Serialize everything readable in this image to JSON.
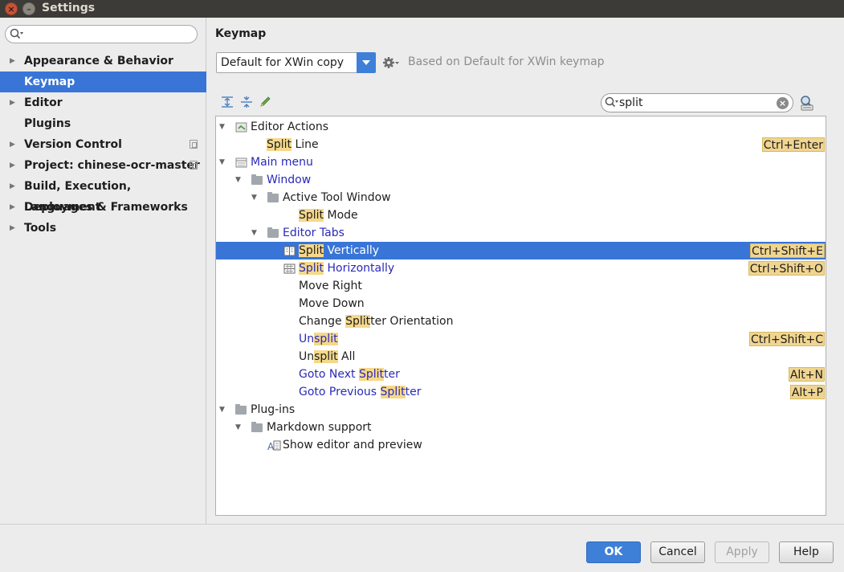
{
  "window": {
    "title": "Settings"
  },
  "sidebar": {
    "search_placeholder": "",
    "items": [
      {
        "label": "Appearance & Behavior",
        "expandable": true
      },
      {
        "label": "Keymap",
        "expandable": false,
        "selected": true
      },
      {
        "label": "Editor",
        "expandable": true
      },
      {
        "label": "Plugins",
        "expandable": false
      },
      {
        "label": "Version Control",
        "expandable": true,
        "project_icon": true
      },
      {
        "label": "Project: chinese-ocr-master",
        "expandable": true,
        "project_icon": true
      },
      {
        "label": "Build, Execution, Deployment",
        "expandable": true
      },
      {
        "label": "Languages & Frameworks",
        "expandable": true
      },
      {
        "label": "Tools",
        "expandable": true
      }
    ]
  },
  "keymap": {
    "title": "Keymap",
    "scheme": "Default for XWin copy",
    "based_on": "Based on Default for XWin keymap",
    "search_value": "split"
  },
  "tree": [
    {
      "parts": [
        [
          "Editor Actions",
          false
        ]
      ],
      "blue": false,
      "shortcut": ""
    },
    {
      "parts": [
        [
          "Split",
          true
        ],
        [
          " Line",
          false
        ]
      ],
      "blue": false,
      "shortcut": "Ctrl+Enter"
    },
    {
      "parts": [
        [
          "Main menu",
          false
        ]
      ],
      "blue": true,
      "shortcut": ""
    },
    {
      "parts": [
        [
          "Window",
          false
        ]
      ],
      "blue": true,
      "shortcut": ""
    },
    {
      "parts": [
        [
          "Active Tool Window",
          false
        ]
      ],
      "blue": false,
      "shortcut": ""
    },
    {
      "parts": [
        [
          "Split",
          true
        ],
        [
          " Mode",
          false
        ]
      ],
      "blue": false,
      "shortcut": ""
    },
    {
      "parts": [
        [
          "Editor Tabs",
          false
        ]
      ],
      "blue": true,
      "shortcut": ""
    },
    {
      "parts": [
        [
          "Split",
          true
        ],
        [
          " Vertically",
          false
        ]
      ],
      "blue": true,
      "shortcut": "Ctrl+Shift+E",
      "selected": true
    },
    {
      "parts": [
        [
          "Split",
          true
        ],
        [
          " Horizontally",
          false
        ]
      ],
      "blue": true,
      "shortcut": "Ctrl+Shift+O"
    },
    {
      "parts": [
        [
          "Move Right",
          false
        ]
      ],
      "blue": false,
      "shortcut": ""
    },
    {
      "parts": [
        [
          "Move Down",
          false
        ]
      ],
      "blue": false,
      "shortcut": ""
    },
    {
      "parts": [
        [
          "Change ",
          false
        ],
        [
          "Split",
          true
        ],
        [
          "ter Orientation",
          false
        ]
      ],
      "blue": false,
      "shortcut": ""
    },
    {
      "parts": [
        [
          "Un",
          false
        ],
        [
          "split",
          true
        ]
      ],
      "blue": true,
      "shortcut": "Ctrl+Shift+C"
    },
    {
      "parts": [
        [
          "Un",
          false
        ],
        [
          "split",
          true
        ],
        [
          " All",
          false
        ]
      ],
      "blue": false,
      "shortcut": ""
    },
    {
      "parts": [
        [
          "Goto Next ",
          false
        ],
        [
          "Split",
          true
        ],
        [
          "ter",
          false
        ]
      ],
      "blue": true,
      "shortcut": "Alt+N"
    },
    {
      "parts": [
        [
          "Goto Previous ",
          false
        ],
        [
          "Split",
          true
        ],
        [
          "ter",
          false
        ]
      ],
      "blue": true,
      "shortcut": "Alt+P"
    },
    {
      "parts": [
        [
          "Plug-ins",
          false
        ]
      ],
      "blue": false,
      "shortcut": ""
    },
    {
      "parts": [
        [
          "Markdown support",
          false
        ]
      ],
      "blue": false,
      "shortcut": ""
    },
    {
      "parts": [
        [
          "Show editor and preview",
          false
        ]
      ],
      "blue": false,
      "shortcut": ""
    }
  ],
  "buttons": {
    "ok": "OK",
    "cancel": "Cancel",
    "apply": "Apply",
    "help": "Help"
  },
  "colors": {
    "selection": "#3875d7",
    "highlight": "#f5d88a",
    "link_blue": "#2a2ab8"
  }
}
